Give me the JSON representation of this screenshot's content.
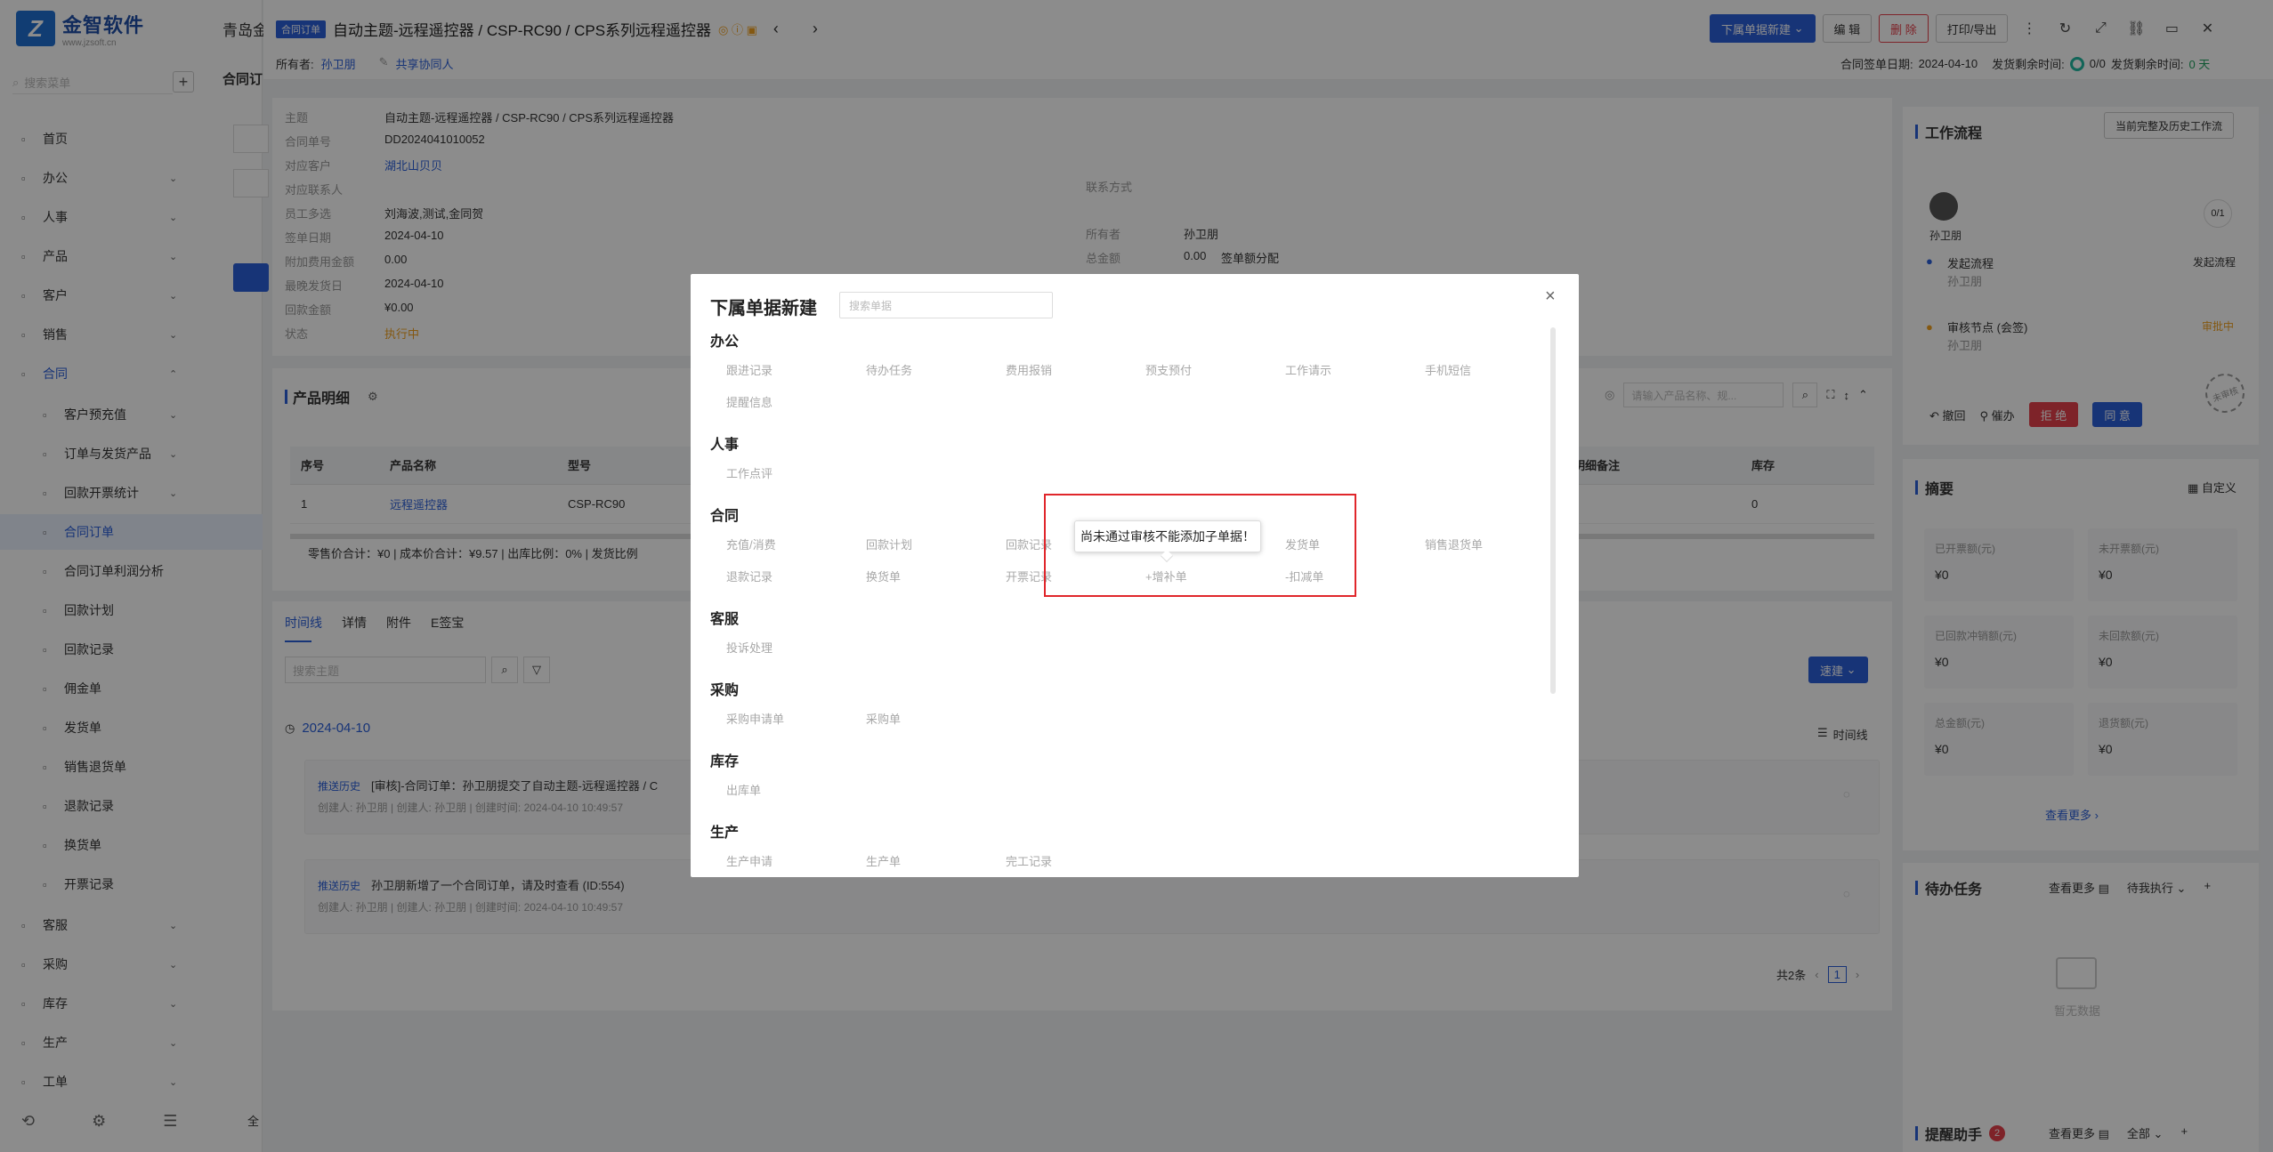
{
  "brand": {
    "name": "金智软件",
    "site": "www.jzsoft.cn"
  },
  "sidebar": {
    "search_placeholder": "搜索菜单",
    "items": [
      {
        "label": "首页",
        "icon": "home-icon"
      },
      {
        "label": "办公",
        "icon": "briefcase-icon"
      },
      {
        "label": "人事",
        "icon": "person-icon"
      },
      {
        "label": "产品",
        "icon": "box-icon"
      },
      {
        "label": "客户",
        "icon": "customer-icon"
      },
      {
        "label": "销售",
        "icon": "sales-icon"
      },
      {
        "label": "合同",
        "icon": "document-icon"
      },
      {
        "label": "客户预充值",
        "icon": "wallet-icon"
      },
      {
        "label": "订单与发货产品",
        "icon": "cart-icon"
      },
      {
        "label": "回款开票统计",
        "icon": "stats-icon"
      },
      {
        "label": "合同订单",
        "icon": "order-icon"
      },
      {
        "label": "合同订单利润分析",
        "icon": "analysis-icon"
      },
      {
        "label": "回款计划",
        "icon": "plan-icon"
      },
      {
        "label": "回款记录",
        "icon": "record-icon"
      },
      {
        "label": "佣金单",
        "icon": "commission-icon"
      },
      {
        "label": "发货单",
        "icon": "ship-icon"
      },
      {
        "label": "销售退货单",
        "icon": "return-icon"
      },
      {
        "label": "退款记录",
        "icon": "refund-icon"
      },
      {
        "label": "换货单",
        "icon": "exchange-icon"
      },
      {
        "label": "开票记录",
        "icon": "invoice-icon"
      },
      {
        "label": "客服",
        "icon": "service-icon"
      },
      {
        "label": "采购",
        "icon": "purchase-icon"
      },
      {
        "label": "库存",
        "icon": "stock-icon"
      },
      {
        "label": "生产",
        "icon": "production-icon"
      },
      {
        "label": "工单",
        "icon": "ticket-icon"
      }
    ]
  },
  "tabs_bg": {
    "company": "青岛金",
    "tab": "合同订",
    "tab_bottom": "全"
  },
  "header": {
    "badge": "合同订单",
    "title": "自动主题-远程遥控器 / CSP-RC90 / CPS系列远程遥控器",
    "owner_label": "所有者:",
    "owner": "孙卫朋",
    "share": "共享协同人",
    "buttons": {
      "new_sub": "下属单据新建",
      "edit": "编 辑",
      "delete": "删 除",
      "print": "打印/导出"
    },
    "sign_date_label": "合同签单日期:",
    "sign_date": "2024-04-10",
    "ship_left_label": "发货剩余时间:",
    "ship_ratio": "0/0",
    "ship_left_label2": "发货剩余时间:",
    "ship_days": "0 天"
  },
  "detail": {
    "fields": [
      {
        "label": "主题",
        "value": "自动主题-远程遥控器 / CSP-RC90 / CPS系列远程遥控器"
      },
      {
        "label": "合同单号",
        "value": "DD2024041010052"
      },
      {
        "label": "对应客户",
        "value": "湖北山贝贝"
      },
      {
        "label": "对应联系人",
        "value": ""
      },
      {
        "label": "员工多选",
        "value": "刘海波,测试,金同贺"
      },
      {
        "label": "签单日期",
        "value": "2024-04-10"
      },
      {
        "label": "附加费用金额",
        "value": "0.00"
      },
      {
        "label": "最晚发货日",
        "value": "2024-04-10"
      },
      {
        "label": "回款金额",
        "value": "¥0.00"
      },
      {
        "label": "状态",
        "value": "执行中"
      }
    ],
    "right_fields": [
      {
        "label": "联系方式",
        "value": ""
      },
      {
        "label": "所有者",
        "value": "孙卫朋"
      },
      {
        "label": "总金额",
        "value": "0.00"
      }
    ],
    "split_link": "签单额分配"
  },
  "products": {
    "title": "产品明细",
    "search_placeholder": "请输入产品名称、规...",
    "columns": [
      "序号",
      "产品名称",
      "型号",
      "明细备注",
      "库存"
    ],
    "rows": [
      {
        "no": "1",
        "name": "远程遥控器",
        "model": "CSP-RC90",
        "note": "",
        "stock": "0"
      }
    ],
    "summary": "零售价合计：¥0 |   成本价合计：¥9.57 |   出库比例：0% |   发货比例"
  },
  "timeline": {
    "tabs": [
      "时间线",
      "详情",
      "附件",
      "E签宝"
    ],
    "search_placeholder": "搜索主题",
    "quick_new": "速建",
    "date": "2024-04-10",
    "view_label": "时间线",
    "entries": [
      {
        "tag": "推送历史",
        "text": "[审核]-合同订单：孙卫朋提交了自动主题-远程遥控器 / C",
        "meta": "创建人: 孙卫朋  |  创建人: 孙卫朋  |  创建时间: 2024-04-10 10:49:57"
      },
      {
        "tag": "推送历史",
        "text": "孙卫朋新增了一个合同订单，请及时查看 (ID:554)",
        "meta": "创建人: 孙卫朋  |  创建人: 孙卫朋  |  创建时间: 2024-04-10 10:49:57"
      }
    ],
    "total": "共2条",
    "page": "1"
  },
  "workflow": {
    "title": "工作流程",
    "history_btn": "当前完整及历史工作流",
    "user": "孙卫朋",
    "count": "0/1",
    "steps": [
      {
        "name": "发起流程",
        "user": "孙卫朋",
        "status": "发起流程"
      },
      {
        "name": "审核节点 (会签)",
        "user": "孙卫朋",
        "status": "审批中"
      }
    ],
    "stamp": "未审核",
    "actions": {
      "withdraw": "撤回",
      "urge": "催办",
      "reject": "拒 绝",
      "agree": "同 意"
    }
  },
  "summary": {
    "title": "摘要",
    "customize": "自定义",
    "items": [
      {
        "label": "已开票额(元)",
        "value": "¥0"
      },
      {
        "label": "未开票额(元)",
        "value": "¥0"
      },
      {
        "label": "已回款冲销额(元)",
        "value": "¥0"
      },
      {
        "label": "未回款额(元)",
        "value": "¥0"
      },
      {
        "label": "总金额(元)",
        "value": "¥0"
      },
      {
        "label": "退货额(元)",
        "value": "¥0"
      }
    ],
    "more": "查看更多"
  },
  "todo": {
    "title": "待办任务",
    "more": "查看更多",
    "filter": "待我执行",
    "empty": "暂无数据"
  },
  "reminder": {
    "title": "提醒助手",
    "count": "2",
    "more": "查看更多",
    "filter": "全部"
  },
  "modal": {
    "title": "下属单据新建",
    "search_placeholder": "搜索单据",
    "categories": [
      {
        "name": "办公",
        "items": [
          "跟进记录",
          "待办任务",
          "费用报销",
          "预支预付",
          "工作请示",
          "手机短信",
          "提醒信息"
        ]
      },
      {
        "name": "人事",
        "items": [
          "工作点评"
        ]
      },
      {
        "name": "合同",
        "items": [
          "充值/消费",
          "回款计划",
          "回款记录",
          "",
          "发货单",
          "销售退货单",
          "退款记录",
          "换货单",
          "开票记录",
          "+增补单",
          "-扣减单"
        ]
      },
      {
        "name": "客服",
        "items": [
          "投诉处理"
        ]
      },
      {
        "name": "采购",
        "items": [
          "采购申请单",
          "采购单"
        ]
      },
      {
        "name": "库存",
        "items": [
          "出库单"
        ]
      },
      {
        "name": "生产",
        "items": [
          "生产申请",
          "生产单",
          "完工记录"
        ]
      }
    ],
    "tooltip": "尚未通过审核不能添加子单据！"
  }
}
